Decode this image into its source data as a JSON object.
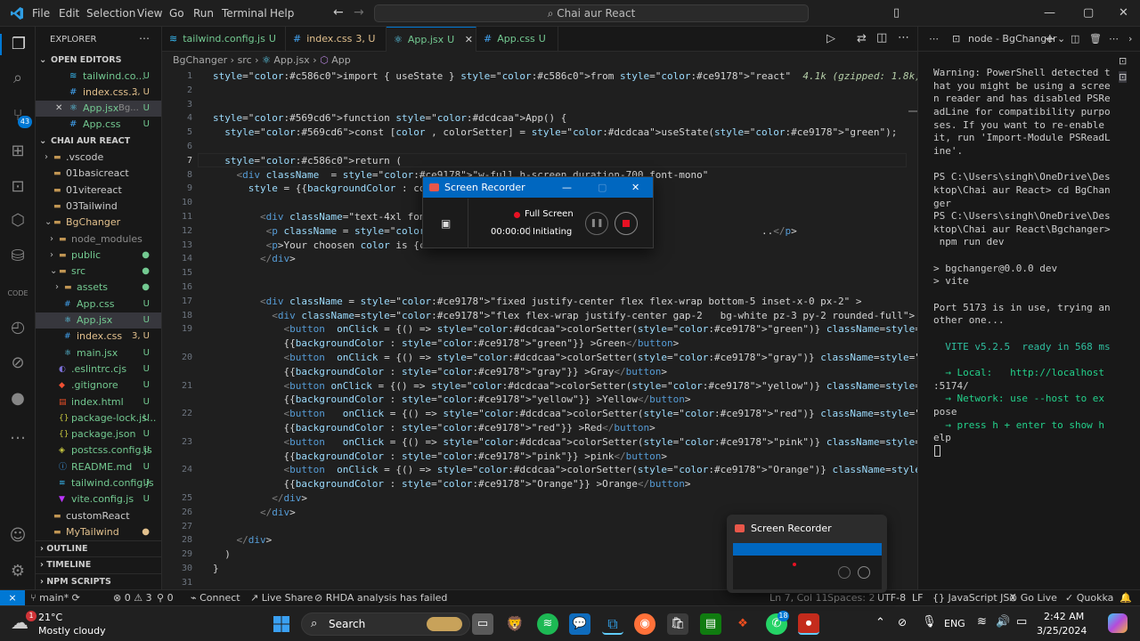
{
  "menu": [
    "File",
    "Edit",
    "Selection",
    "View",
    "Go",
    "Run",
    "Terminal",
    "Help"
  ],
  "window_title": "Chai aur React",
  "sidebar": {
    "title": "EXPLORER",
    "open_editors_header": "OPEN EDITORS",
    "open_editors": [
      {
        "name": "tailwind.co...",
        "badge": "U"
      },
      {
        "name": "index.css...",
        "badge": "3, U"
      },
      {
        "name": "App.jsx",
        "extra": "Bg...",
        "badge": "U"
      },
      {
        "name": "App.css",
        "badge": "U"
      }
    ],
    "workspace_header": "CHAI AUR REACT",
    "tree": [
      {
        "name": ".vscode",
        "badge": ""
      },
      {
        "name": "01basicreact",
        "badge": ""
      },
      {
        "name": "01vitereact",
        "badge": ""
      },
      {
        "name": "03Tailwind",
        "badge": ""
      },
      {
        "name": "BgChanger",
        "badge": ""
      },
      {
        "name": "node_modules",
        "badge": ""
      },
      {
        "name": "public",
        "badge": "●"
      },
      {
        "name": "src",
        "badge": "●"
      },
      {
        "name": "assets",
        "badge": "●"
      },
      {
        "name": "App.css",
        "badge": "U"
      },
      {
        "name": "App.jsx",
        "badge": "U"
      },
      {
        "name": "index.css",
        "badge": "3, U"
      },
      {
        "name": "main.jsx",
        "badge": "U"
      },
      {
        "name": ".eslintrc.cjs",
        "badge": "U"
      },
      {
        "name": ".gitignore",
        "badge": "U"
      },
      {
        "name": "index.html",
        "badge": "U"
      },
      {
        "name": "package-lock.js...",
        "badge": "U"
      },
      {
        "name": "package.json",
        "badge": "U"
      },
      {
        "name": "postcss.config.js",
        "badge": "U"
      },
      {
        "name": "README.md",
        "badge": "U"
      },
      {
        "name": "tailwind.config.js",
        "badge": "U"
      },
      {
        "name": "vite.config.js",
        "badge": "U"
      },
      {
        "name": "customReact",
        "badge": ""
      },
      {
        "name": "MyTailwind",
        "badge": "●"
      }
    ],
    "outline": "OUTLINE",
    "timeline": "TIMELINE",
    "npm_scripts": "NPM SCRIPTS"
  },
  "tabs": [
    {
      "label": "tailwind.config.js",
      "mod": "U"
    },
    {
      "label": "index.css",
      "mod": "3, U"
    },
    {
      "label": "App.jsx",
      "mod": "U"
    },
    {
      "label": "App.css",
      "mod": "U"
    }
  ],
  "breadcrumb": [
    "BgChanger",
    "src",
    "App.jsx",
    "App"
  ],
  "line_numbers": [
    "1",
    "2",
    "3",
    "4",
    "5",
    "6",
    "7",
    "8",
    "9",
    "10",
    "11",
    "12",
    "13",
    "14",
    "15",
    "16",
    "17",
    "18",
    "19",
    "",
    "20",
    "",
    "21",
    "",
    "22",
    "",
    "23",
    "",
    "24",
    "",
    "25",
    "26",
    "27",
    "28",
    "29",
    "30",
    "31"
  ],
  "code": [
    "import { useState } from \"react\"  4.1k (gzipped: 1.8k)",
    "",
    "",
    "function App() {",
    "  const [color , colorSetter] = useState(\"green\");",
    "",
    "  return (",
    "    <div className  = \"w-full h-screen duration-700 font-mono\"",
    "      style = {{backgroundColor : col",
    "",
    "        <div className=\"text-4xl font",
    "         <p className = \"py-10\"> Hi C                                  ..</p>",
    "         <p>Your choosen color is {co",
    "        </div>",
    "",
    "",
    "        <div className = \"fixed justify-center flex flex-wrap bottom-5 inset-x-0 px-2\" >",
    "          <div className=\"flex flex-wrap justify-center gap-2   bg-white pz-3 py-2 rounded-full\">",
    "            <button  onClick = {() => colorSetter(\"green\")} className=\"outline-none px-4 py-1 rounded-full\" style=",
    "            {{backgroundColor : \"green\"}} >Green</button>",
    "            <button  onClick = {() => colorSetter(\"gray\")} className=\"outline-none px-4 rounded-full \" style=",
    "            {{backgroundColor : \"gray\"}} >Gray</button>",
    "            <button onClick = {() => colorSetter(\"yellow\")} className=\"outline-none px-4 rounded-full \" style=",
    "            {{backgroundColor : \"yellow\"}} >Yellow</button>",
    "            <button   onClick = {() => colorSetter(\"red\")} className=\"outline-none px-4  rounded-full\" style=",
    "            {{backgroundColor : \"red\"}} >Red</button>",
    "            <button   onClick = {() => colorSetter(\"pink\")} className=\"outline-none px-4  rounded-full\" style=",
    "            {{backgroundColor : \"pink\"}} >pink</button>",
    "            <button  onClick = {() => colorSetter(\"Orange\")} className=\"outline-none px-4  rounded-full\" style=",
    "            {{backgroundColor : \"Orange\"}} >Orange</button>",
    "          </div>",
    "        </div>",
    "",
    "    </div>",
    "  )",
    "}",
    ""
  ],
  "terminal": {
    "title": "node - BgChanger",
    "lines": [
      "Warning: PowerShell detected t",
      "hat you might be using a scree",
      "n reader and has disabled PSRe",
      "adLine for compatibility purpo",
      "ses. If you want to re-enable",
      "it, run 'Import-Module PSReadL",
      "ine'.",
      "",
      "PS C:\\Users\\singh\\OneDrive\\Des",
      "ktop\\Chai aur React> cd BgChan",
      "ger",
      "PS C:\\Users\\singh\\OneDrive\\Des",
      "ktop\\Chai aur React\\Bgchanger>",
      " npm run dev",
      "",
      "> bgchanger@0.0.0 dev",
      "> vite",
      "",
      "Port 5173 is in use, trying an",
      "other one...",
      "",
      "  VITE v5.2.5  ready in 568 ms",
      "",
      "  → Local:   http://localhost",
      ":5174/",
      "  → Network: use --host to ex",
      "pose",
      "  → press h + enter to show h",
      "elp"
    ]
  },
  "recorder": {
    "title": "Screen Recorder",
    "mode": "Full Screen",
    "time": "00:00:00",
    "status": "Initiating"
  },
  "recorder_thumb": {
    "title": "Screen Recorder"
  },
  "status": {
    "branch": "main*",
    "problems": "0 ⚠ 3",
    "ports": "0",
    "connect": "Connect",
    "live_share": "Live Share",
    "rhda": "RHDA analysis has failed",
    "position": "Ln 7, Col 11",
    "spaces": "Spaces: 2",
    "encoding": "UTF-8",
    "eol": "LF",
    "language": "JavaScript JSX",
    "go_live": "Go Live",
    "quokka": "Quokka"
  },
  "taskbar": {
    "weather_temp": "21°C",
    "weather_desc": "Mostly cloudy",
    "search": "Search",
    "lang": "ENG",
    "time": "2:42 AM",
    "date": "3/25/2024",
    "whatsapp_badge": "18",
    "weather_badge": "1"
  },
  "colors": {
    "accent": "#0078d4",
    "keyword": "#569cd6",
    "control": "#c586c0",
    "string": "#ce9178",
    "function": "#dcdcaa",
    "variable": "#9cdcfe",
    "tag": "#569cd6",
    "untracked": "#73c991",
    "modified": "#e2c08d"
  }
}
